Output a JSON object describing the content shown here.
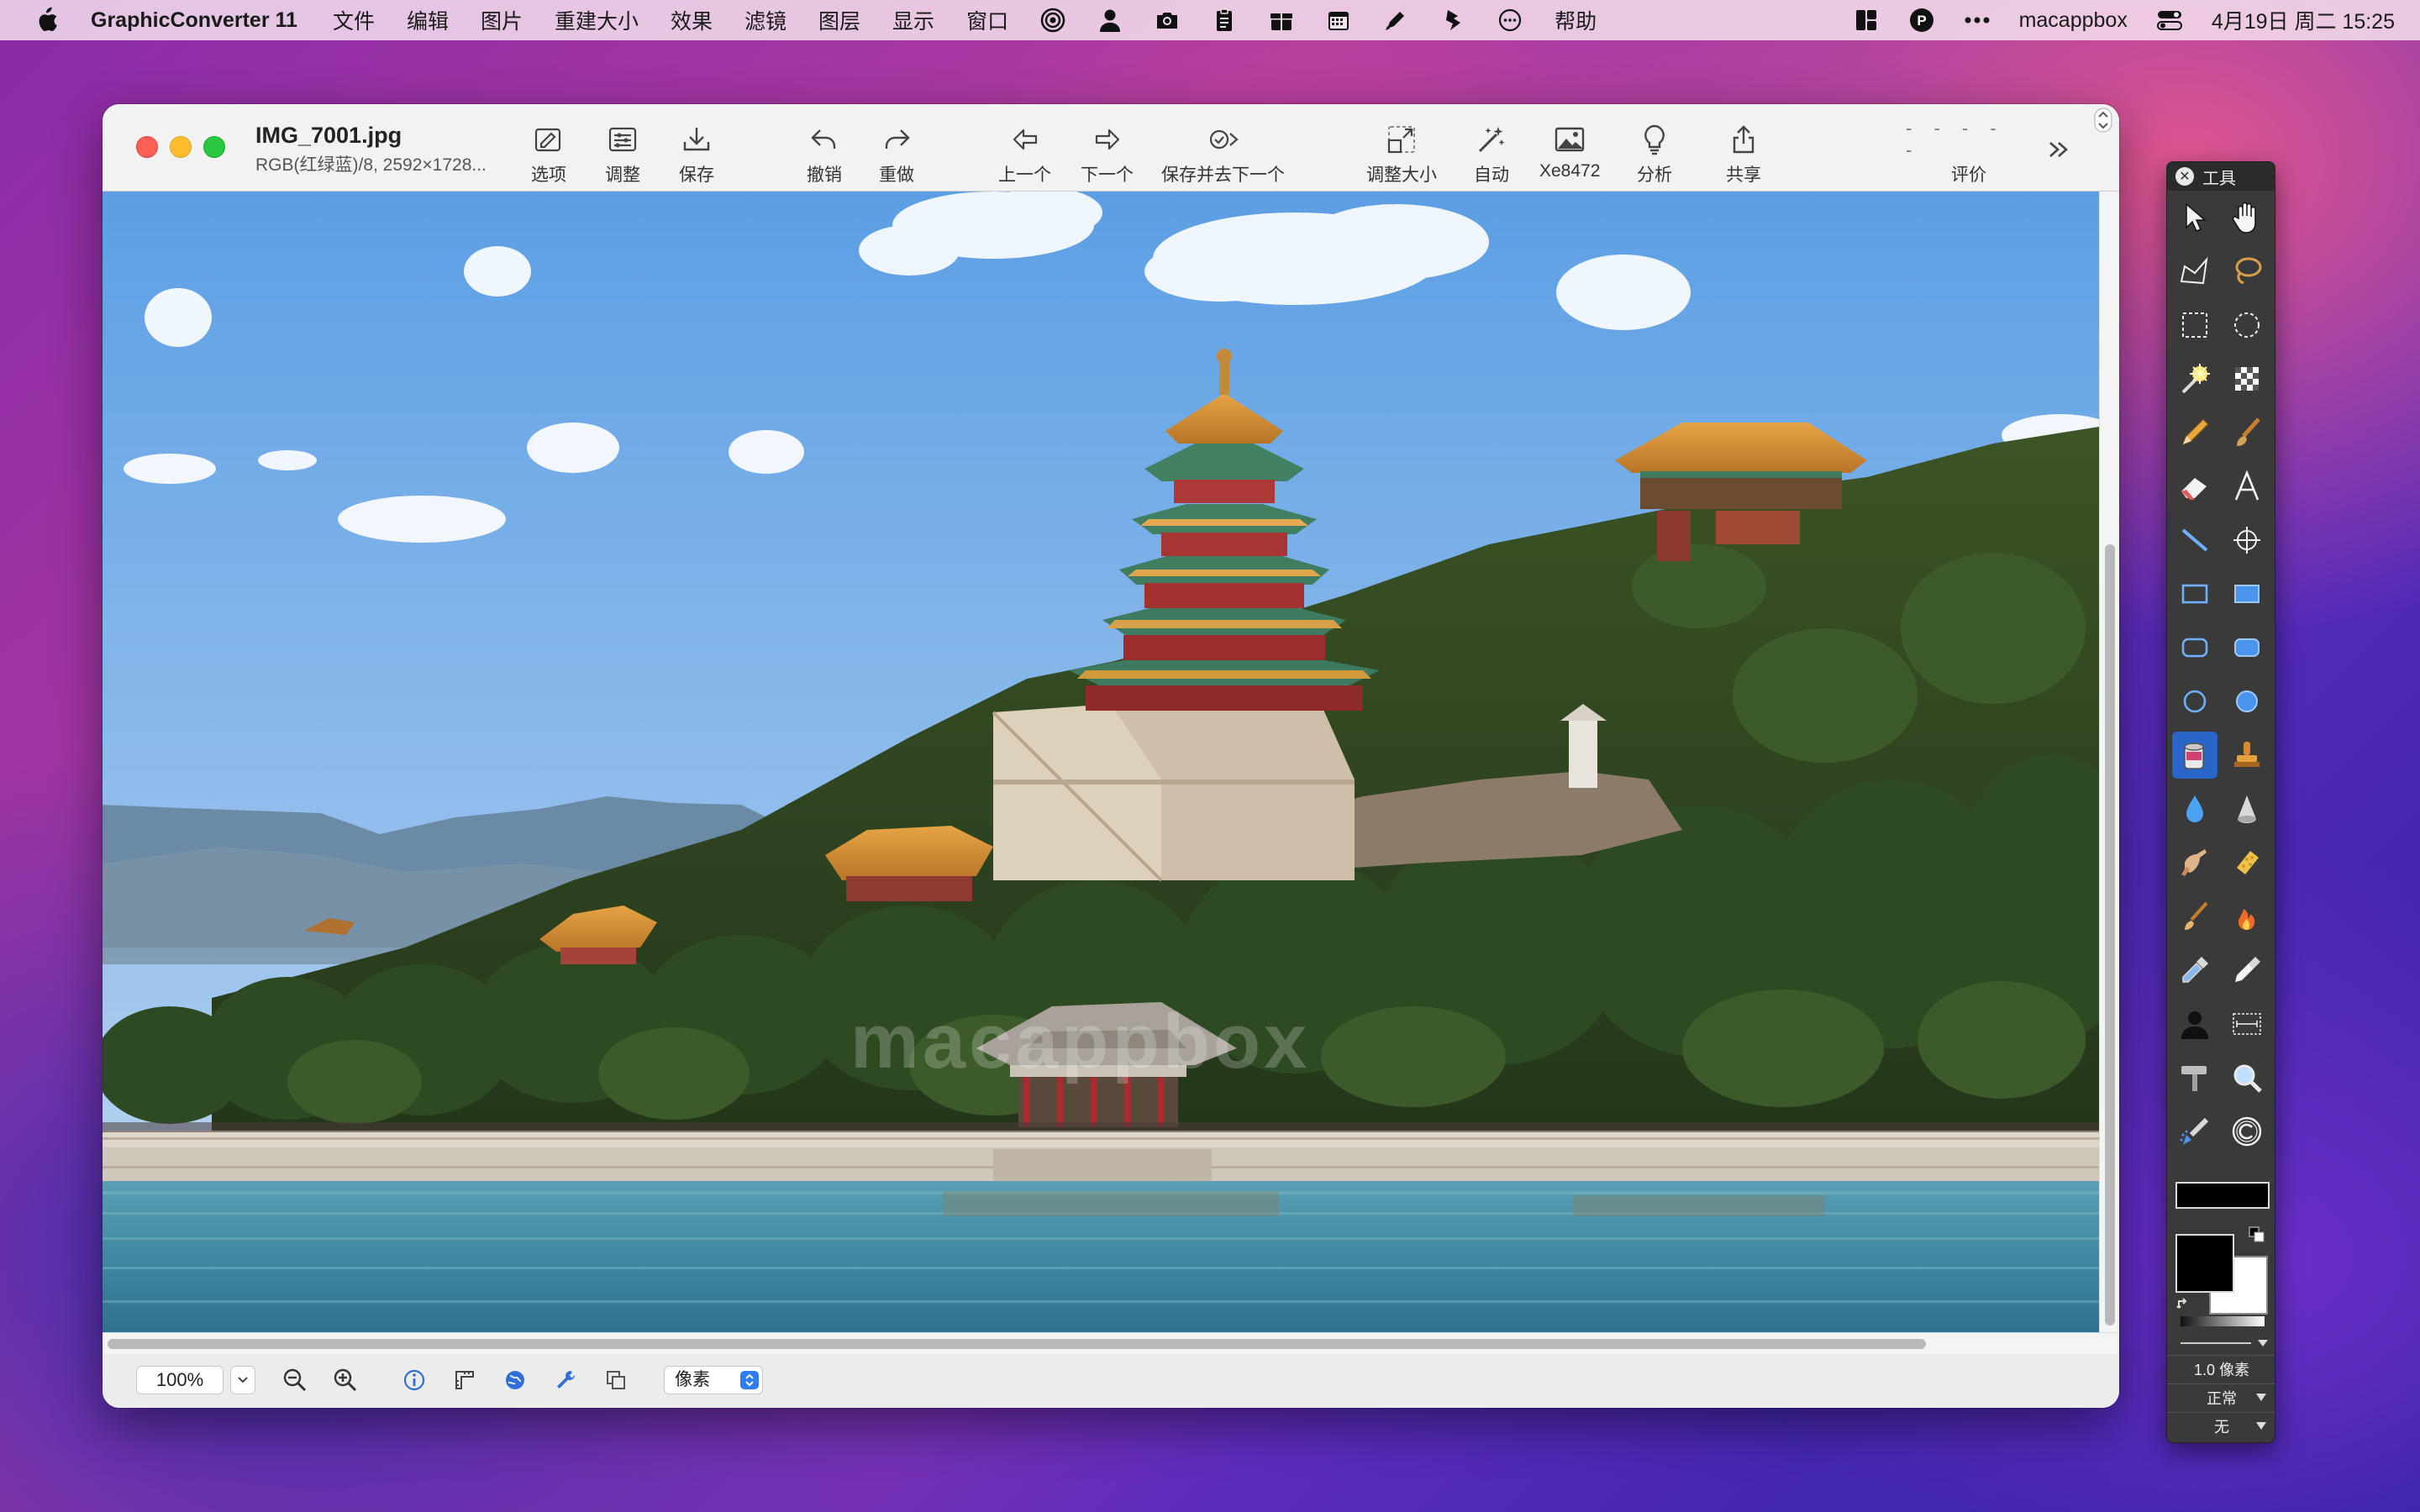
{
  "menubar": {
    "app_name": "GraphicConverter 11",
    "items": [
      "文件",
      "编辑",
      "图片",
      "重建大小",
      "效果",
      "滤镜",
      "图层",
      "显示",
      "窗口"
    ],
    "icons": [
      "target-icon",
      "person-icon",
      "camera-icon",
      "clipboard-icon",
      "gift-icon",
      "calendar-icon",
      "pen-icon",
      "shortcut-icon",
      "chat-icon"
    ],
    "help": "帮助",
    "user": "macappbox",
    "datetime": "4月19日 周二  15:25"
  },
  "window": {
    "title": "IMG_7001.jpg",
    "subtitle": "RGB(红绿蓝)/8, 2592×1728...",
    "toolbar": {
      "options": "选项",
      "adjust": "调整",
      "save": "保存",
      "undo": "撤销",
      "redo": "重做",
      "previous": "上一个",
      "next": "下一个",
      "save_next": "保存并去下一个",
      "resize": "调整大小",
      "auto": "自动",
      "xe": "Xe8472",
      "analyze": "分析",
      "share": "共享",
      "rating_dots": "- - - - -",
      "rating": "评价"
    },
    "image": {
      "watermark": "macappbox"
    },
    "status": {
      "zoom": "100%",
      "unit": "像素"
    }
  },
  "palette": {
    "title": "工具",
    "line_width": "1.0 像素",
    "mode": "正常",
    "none": "无"
  },
  "colors": {
    "accent": "#2f7df6",
    "close": "#fe5f57",
    "minimize": "#febc2e",
    "maximize": "#28c840"
  }
}
